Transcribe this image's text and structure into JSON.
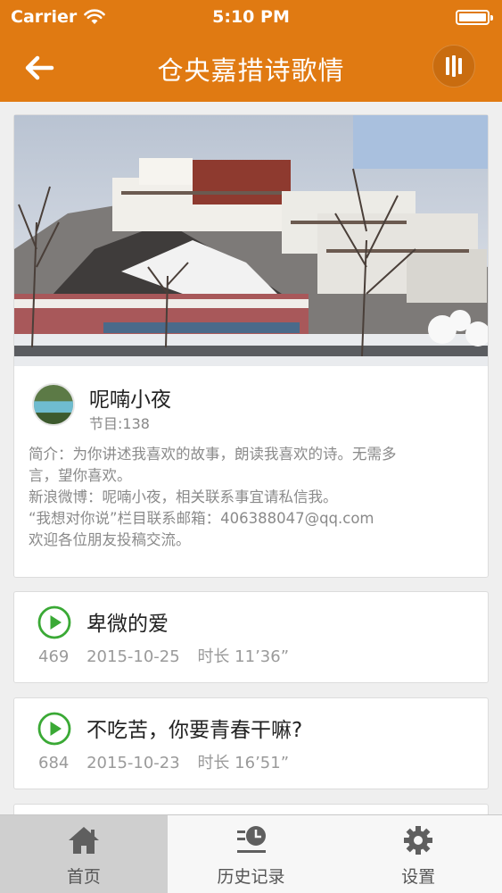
{
  "status_bar": {
    "carrier": "Carrier",
    "time": "5:10 PM"
  },
  "navbar": {
    "title": "仓央嘉措诗歌情",
    "back_icon": "arrow-left-icon",
    "player_icon": "audio-bars-icon"
  },
  "colors": {
    "accent": "#e07a12",
    "play_green": "#3aa935",
    "background": "#efefef"
  },
  "profile": {
    "name": "呢喃小夜",
    "episode_count": "节目:138",
    "description": [
      "简介：为你讲述我喜欢的故事，朗读我喜欢的诗。无需多",
      "言，望你喜欢。",
      "新浪微博：呢喃小夜，相关联系事宜请私信我。",
      "“我想对你说”栏目联系邮箱：406388047@qq.com",
      "欢迎各位朋友投稿交流。"
    ]
  },
  "episodes": [
    {
      "title": "卑微的爱",
      "plays": "469",
      "date": "2015-10-25",
      "duration": "时长 11’36”"
    },
    {
      "title": "不吃苦，你要青春干嘛?",
      "plays": "684",
      "date": "2015-10-23",
      "duration": "时长 16’51”"
    }
  ],
  "tabs": [
    {
      "label": "首页",
      "icon": "home-icon",
      "active": true
    },
    {
      "label": "历史记录",
      "icon": "history-icon",
      "active": false
    },
    {
      "label": "设置",
      "icon": "gear-icon",
      "active": false
    }
  ]
}
